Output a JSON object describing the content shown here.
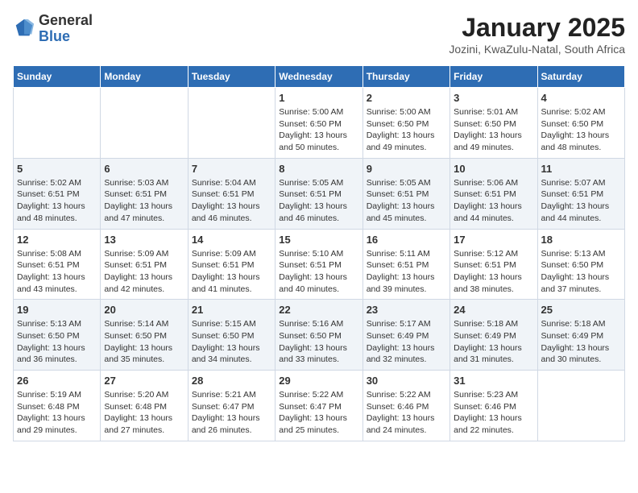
{
  "header": {
    "logo_general": "General",
    "logo_blue": "Blue",
    "month_title": "January 2025",
    "location": "Jozini, KwaZulu-Natal, South Africa"
  },
  "weekdays": [
    "Sunday",
    "Monday",
    "Tuesday",
    "Wednesday",
    "Thursday",
    "Friday",
    "Saturday"
  ],
  "weeks": [
    [
      {
        "day": "",
        "info": ""
      },
      {
        "day": "",
        "info": ""
      },
      {
        "day": "",
        "info": ""
      },
      {
        "day": "1",
        "info": "Sunrise: 5:00 AM\nSunset: 6:50 PM\nDaylight: 13 hours\nand 50 minutes."
      },
      {
        "day": "2",
        "info": "Sunrise: 5:00 AM\nSunset: 6:50 PM\nDaylight: 13 hours\nand 49 minutes."
      },
      {
        "day": "3",
        "info": "Sunrise: 5:01 AM\nSunset: 6:50 PM\nDaylight: 13 hours\nand 49 minutes."
      },
      {
        "day": "4",
        "info": "Sunrise: 5:02 AM\nSunset: 6:50 PM\nDaylight: 13 hours\nand 48 minutes."
      }
    ],
    [
      {
        "day": "5",
        "info": "Sunrise: 5:02 AM\nSunset: 6:51 PM\nDaylight: 13 hours\nand 48 minutes."
      },
      {
        "day": "6",
        "info": "Sunrise: 5:03 AM\nSunset: 6:51 PM\nDaylight: 13 hours\nand 47 minutes."
      },
      {
        "day": "7",
        "info": "Sunrise: 5:04 AM\nSunset: 6:51 PM\nDaylight: 13 hours\nand 46 minutes."
      },
      {
        "day": "8",
        "info": "Sunrise: 5:05 AM\nSunset: 6:51 PM\nDaylight: 13 hours\nand 46 minutes."
      },
      {
        "day": "9",
        "info": "Sunrise: 5:05 AM\nSunset: 6:51 PM\nDaylight: 13 hours\nand 45 minutes."
      },
      {
        "day": "10",
        "info": "Sunrise: 5:06 AM\nSunset: 6:51 PM\nDaylight: 13 hours\nand 44 minutes."
      },
      {
        "day": "11",
        "info": "Sunrise: 5:07 AM\nSunset: 6:51 PM\nDaylight: 13 hours\nand 44 minutes."
      }
    ],
    [
      {
        "day": "12",
        "info": "Sunrise: 5:08 AM\nSunset: 6:51 PM\nDaylight: 13 hours\nand 43 minutes."
      },
      {
        "day": "13",
        "info": "Sunrise: 5:09 AM\nSunset: 6:51 PM\nDaylight: 13 hours\nand 42 minutes."
      },
      {
        "day": "14",
        "info": "Sunrise: 5:09 AM\nSunset: 6:51 PM\nDaylight: 13 hours\nand 41 minutes."
      },
      {
        "day": "15",
        "info": "Sunrise: 5:10 AM\nSunset: 6:51 PM\nDaylight: 13 hours\nand 40 minutes."
      },
      {
        "day": "16",
        "info": "Sunrise: 5:11 AM\nSunset: 6:51 PM\nDaylight: 13 hours\nand 39 minutes."
      },
      {
        "day": "17",
        "info": "Sunrise: 5:12 AM\nSunset: 6:51 PM\nDaylight: 13 hours\nand 38 minutes."
      },
      {
        "day": "18",
        "info": "Sunrise: 5:13 AM\nSunset: 6:50 PM\nDaylight: 13 hours\nand 37 minutes."
      }
    ],
    [
      {
        "day": "19",
        "info": "Sunrise: 5:13 AM\nSunset: 6:50 PM\nDaylight: 13 hours\nand 36 minutes."
      },
      {
        "day": "20",
        "info": "Sunrise: 5:14 AM\nSunset: 6:50 PM\nDaylight: 13 hours\nand 35 minutes."
      },
      {
        "day": "21",
        "info": "Sunrise: 5:15 AM\nSunset: 6:50 PM\nDaylight: 13 hours\nand 34 minutes."
      },
      {
        "day": "22",
        "info": "Sunrise: 5:16 AM\nSunset: 6:50 PM\nDaylight: 13 hours\nand 33 minutes."
      },
      {
        "day": "23",
        "info": "Sunrise: 5:17 AM\nSunset: 6:49 PM\nDaylight: 13 hours\nand 32 minutes."
      },
      {
        "day": "24",
        "info": "Sunrise: 5:18 AM\nSunset: 6:49 PM\nDaylight: 13 hours\nand 31 minutes."
      },
      {
        "day": "25",
        "info": "Sunrise: 5:18 AM\nSunset: 6:49 PM\nDaylight: 13 hours\nand 30 minutes."
      }
    ],
    [
      {
        "day": "26",
        "info": "Sunrise: 5:19 AM\nSunset: 6:48 PM\nDaylight: 13 hours\nand 29 minutes."
      },
      {
        "day": "27",
        "info": "Sunrise: 5:20 AM\nSunset: 6:48 PM\nDaylight: 13 hours\nand 27 minutes."
      },
      {
        "day": "28",
        "info": "Sunrise: 5:21 AM\nSunset: 6:47 PM\nDaylight: 13 hours\nand 26 minutes."
      },
      {
        "day": "29",
        "info": "Sunrise: 5:22 AM\nSunset: 6:47 PM\nDaylight: 13 hours\nand 25 minutes."
      },
      {
        "day": "30",
        "info": "Sunrise: 5:22 AM\nSunset: 6:46 PM\nDaylight: 13 hours\nand 24 minutes."
      },
      {
        "day": "31",
        "info": "Sunrise: 5:23 AM\nSunset: 6:46 PM\nDaylight: 13 hours\nand 22 minutes."
      },
      {
        "day": "",
        "info": ""
      }
    ]
  ]
}
